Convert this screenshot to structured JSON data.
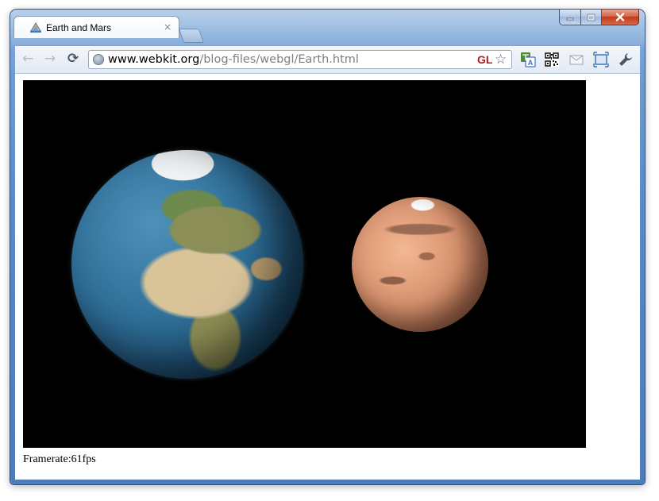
{
  "window": {
    "controls": {
      "minimize_icon": "minimize-icon",
      "maximize_icon": "maximize-icon",
      "close_icon": "close-icon"
    }
  },
  "tabs": [
    {
      "title": "Earth and Mars",
      "favicon": "webkit-favicon",
      "active": true
    }
  ],
  "tab_close_glyph": "×",
  "toolbar": {
    "back_glyph": "←",
    "forward_glyph": "→",
    "reload_glyph": "⟳",
    "url_host": "www.webkit.org",
    "url_path": "/blog-files/webgl/Earth.html",
    "gl_badge": "GL",
    "star_glyph": "☆",
    "extensions": [
      "translate-icon",
      "qr-code-icon",
      "mail-icon",
      "fullscreen-icon",
      "wrench-icon"
    ]
  },
  "content": {
    "canvas": {
      "background": "#000000",
      "bodies": [
        "earth",
        "mars"
      ]
    },
    "framerate_text": "Framerate:61fps"
  },
  "colors": {
    "frame_blue": "#5a8bc6",
    "close_red": "#c2391a",
    "gl_red": "#b01b1b",
    "url_path_gray": "#808080"
  }
}
